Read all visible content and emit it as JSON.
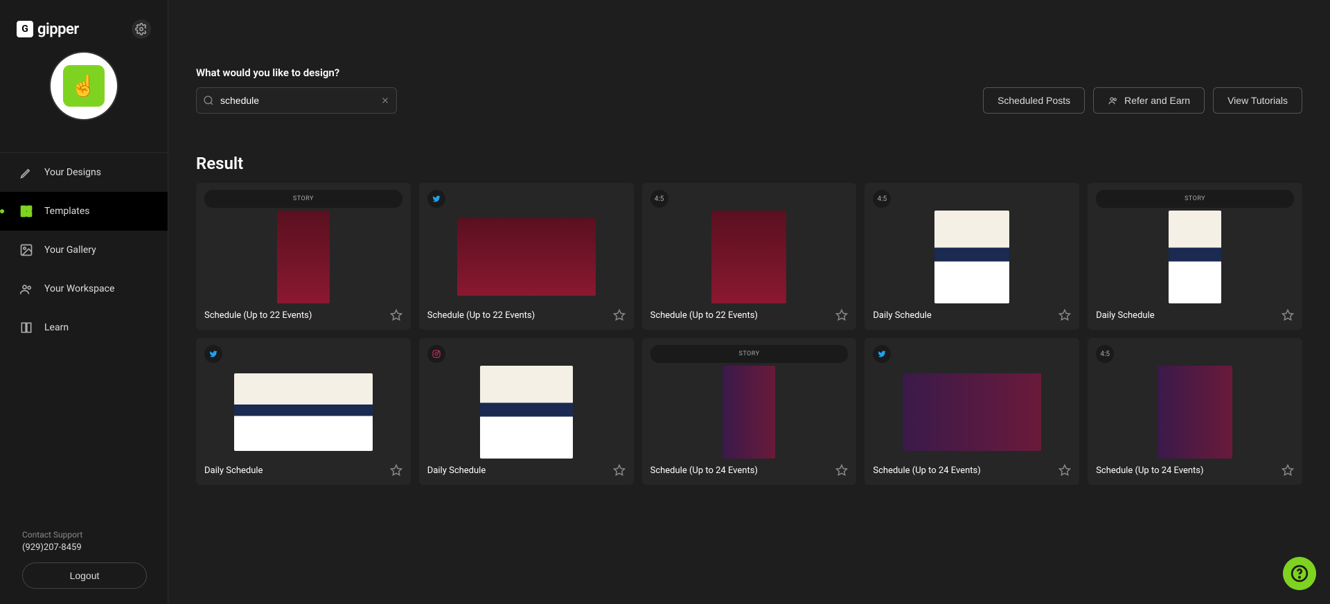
{
  "brand": {
    "name": "gipper",
    "mark": "G"
  },
  "sidebar": {
    "nav": [
      {
        "label": "Your Designs",
        "icon": "pencil-icon"
      },
      {
        "label": "Templates",
        "icon": "templates-icon",
        "active": true
      },
      {
        "label": "Your Gallery",
        "icon": "image-icon"
      },
      {
        "label": "Your Workspace",
        "icon": "users-icon"
      },
      {
        "label": "Learn",
        "icon": "book-icon"
      }
    ],
    "support_label": "Contact Support",
    "support_phone": "(929)207-8459",
    "logout_label": "Logout"
  },
  "header": {
    "prompt": "What would you like to design?",
    "search_value": "schedule",
    "scheduled_posts_label": "Scheduled Posts",
    "refer_label": "Refer and Earn",
    "tutorials_label": "View Tutorials"
  },
  "results": {
    "heading": "Result",
    "cards": [
      {
        "badge": "STORY",
        "badge_kind": "wide",
        "title": "Schedule (Up to 22 Events)",
        "thumb_shape": "story",
        "thumb_style": "basketball"
      },
      {
        "badge": "tw",
        "badge_kind": "icon",
        "icon": "twitter-icon",
        "title": "Schedule (Up to 22 Events)",
        "thumb_shape": "twitter",
        "thumb_style": "basketball"
      },
      {
        "badge": "4:5",
        "badge_kind": "text",
        "title": "Schedule (Up to 22 Events)",
        "thumb_shape": "r45",
        "thumb_style": "basketball"
      },
      {
        "badge": "4:5",
        "badge_kind": "text",
        "title": "Daily Schedule",
        "thumb_shape": "r45",
        "thumb_style": "daily"
      },
      {
        "badge": "STORY",
        "badge_kind": "wide",
        "title": "Daily Schedule",
        "thumb_shape": "story",
        "thumb_style": "daily"
      },
      {
        "badge": "tw",
        "badge_kind": "icon",
        "icon": "twitter-icon",
        "title": "Daily Schedule",
        "thumb_shape": "twitter",
        "thumb_style": "daily"
      },
      {
        "badge": "ig",
        "badge_kind": "icon",
        "icon": "instagram-icon",
        "title": "Daily Schedule",
        "thumb_shape": "insta",
        "thumb_style": "daily"
      },
      {
        "badge": "STORY",
        "badge_kind": "wide",
        "title": "Schedule (Up to 24 Events)",
        "thumb_shape": "story",
        "thumb_style": "purple"
      },
      {
        "badge": "tw",
        "badge_kind": "icon",
        "icon": "twitter-icon",
        "title": "Schedule (Up to 24 Events)",
        "thumb_shape": "twitter",
        "thumb_style": "purple"
      },
      {
        "badge": "4:5",
        "badge_kind": "text",
        "title": "Schedule (Up to 24 Events)",
        "thumb_shape": "r45",
        "thumb_style": "purple"
      }
    ]
  }
}
